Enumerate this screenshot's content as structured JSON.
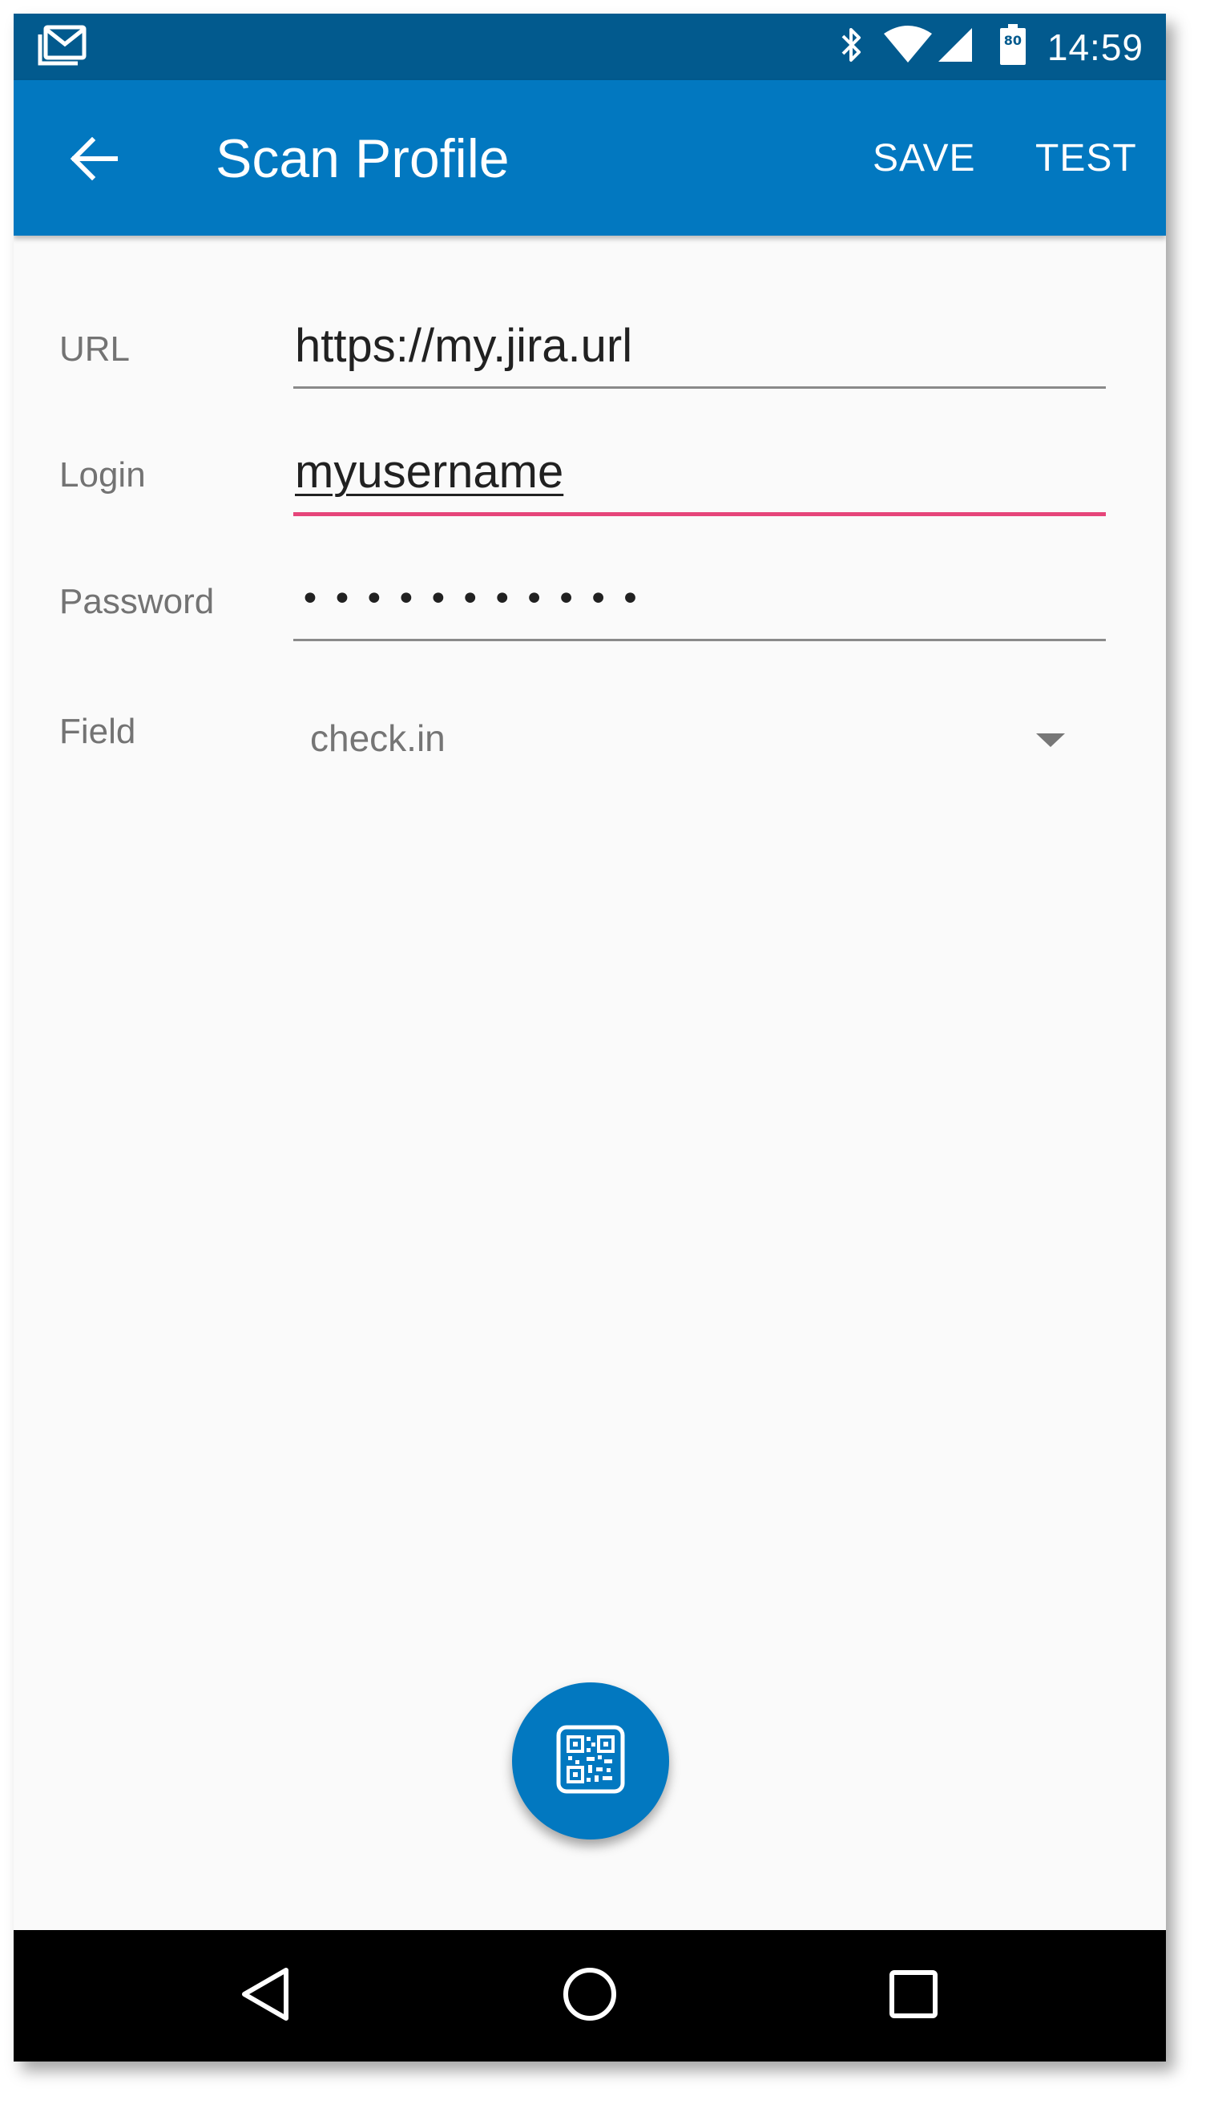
{
  "status_bar": {
    "notification_icon": "gmail-icon",
    "bluetooth_icon": "bluetooth-icon",
    "wifi_icon": "wifi-icon",
    "signal_icon": "cell-signal-icon",
    "battery_icon": "battery-icon",
    "battery_level": "80",
    "time": "14:59"
  },
  "app_bar": {
    "back_icon": "arrow-back-icon",
    "title": "Scan Profile",
    "save_label": "SAVE",
    "test_label": "TEST",
    "background_color": "#0278c0"
  },
  "form": {
    "url": {
      "label": "URL",
      "value": "https://my.jira.url"
    },
    "login": {
      "label": "Login",
      "value": "myusername"
    },
    "password": {
      "label": "Password",
      "value": "•••••••••••"
    },
    "field": {
      "label": "Field",
      "selected": "check.in",
      "dropdown_icon": "arrow-drop-down-icon"
    }
  },
  "fab": {
    "icon": "qr-code-icon",
    "color": "#0278c0"
  },
  "nav_bar": {
    "back_icon": "nav-back-triangle-icon",
    "home_icon": "nav-home-circle-icon",
    "recents_icon": "nav-recents-square-icon"
  },
  "colors": {
    "status_bar": "#025a8e",
    "accent": "#e6457a",
    "background": "#fafafa"
  }
}
